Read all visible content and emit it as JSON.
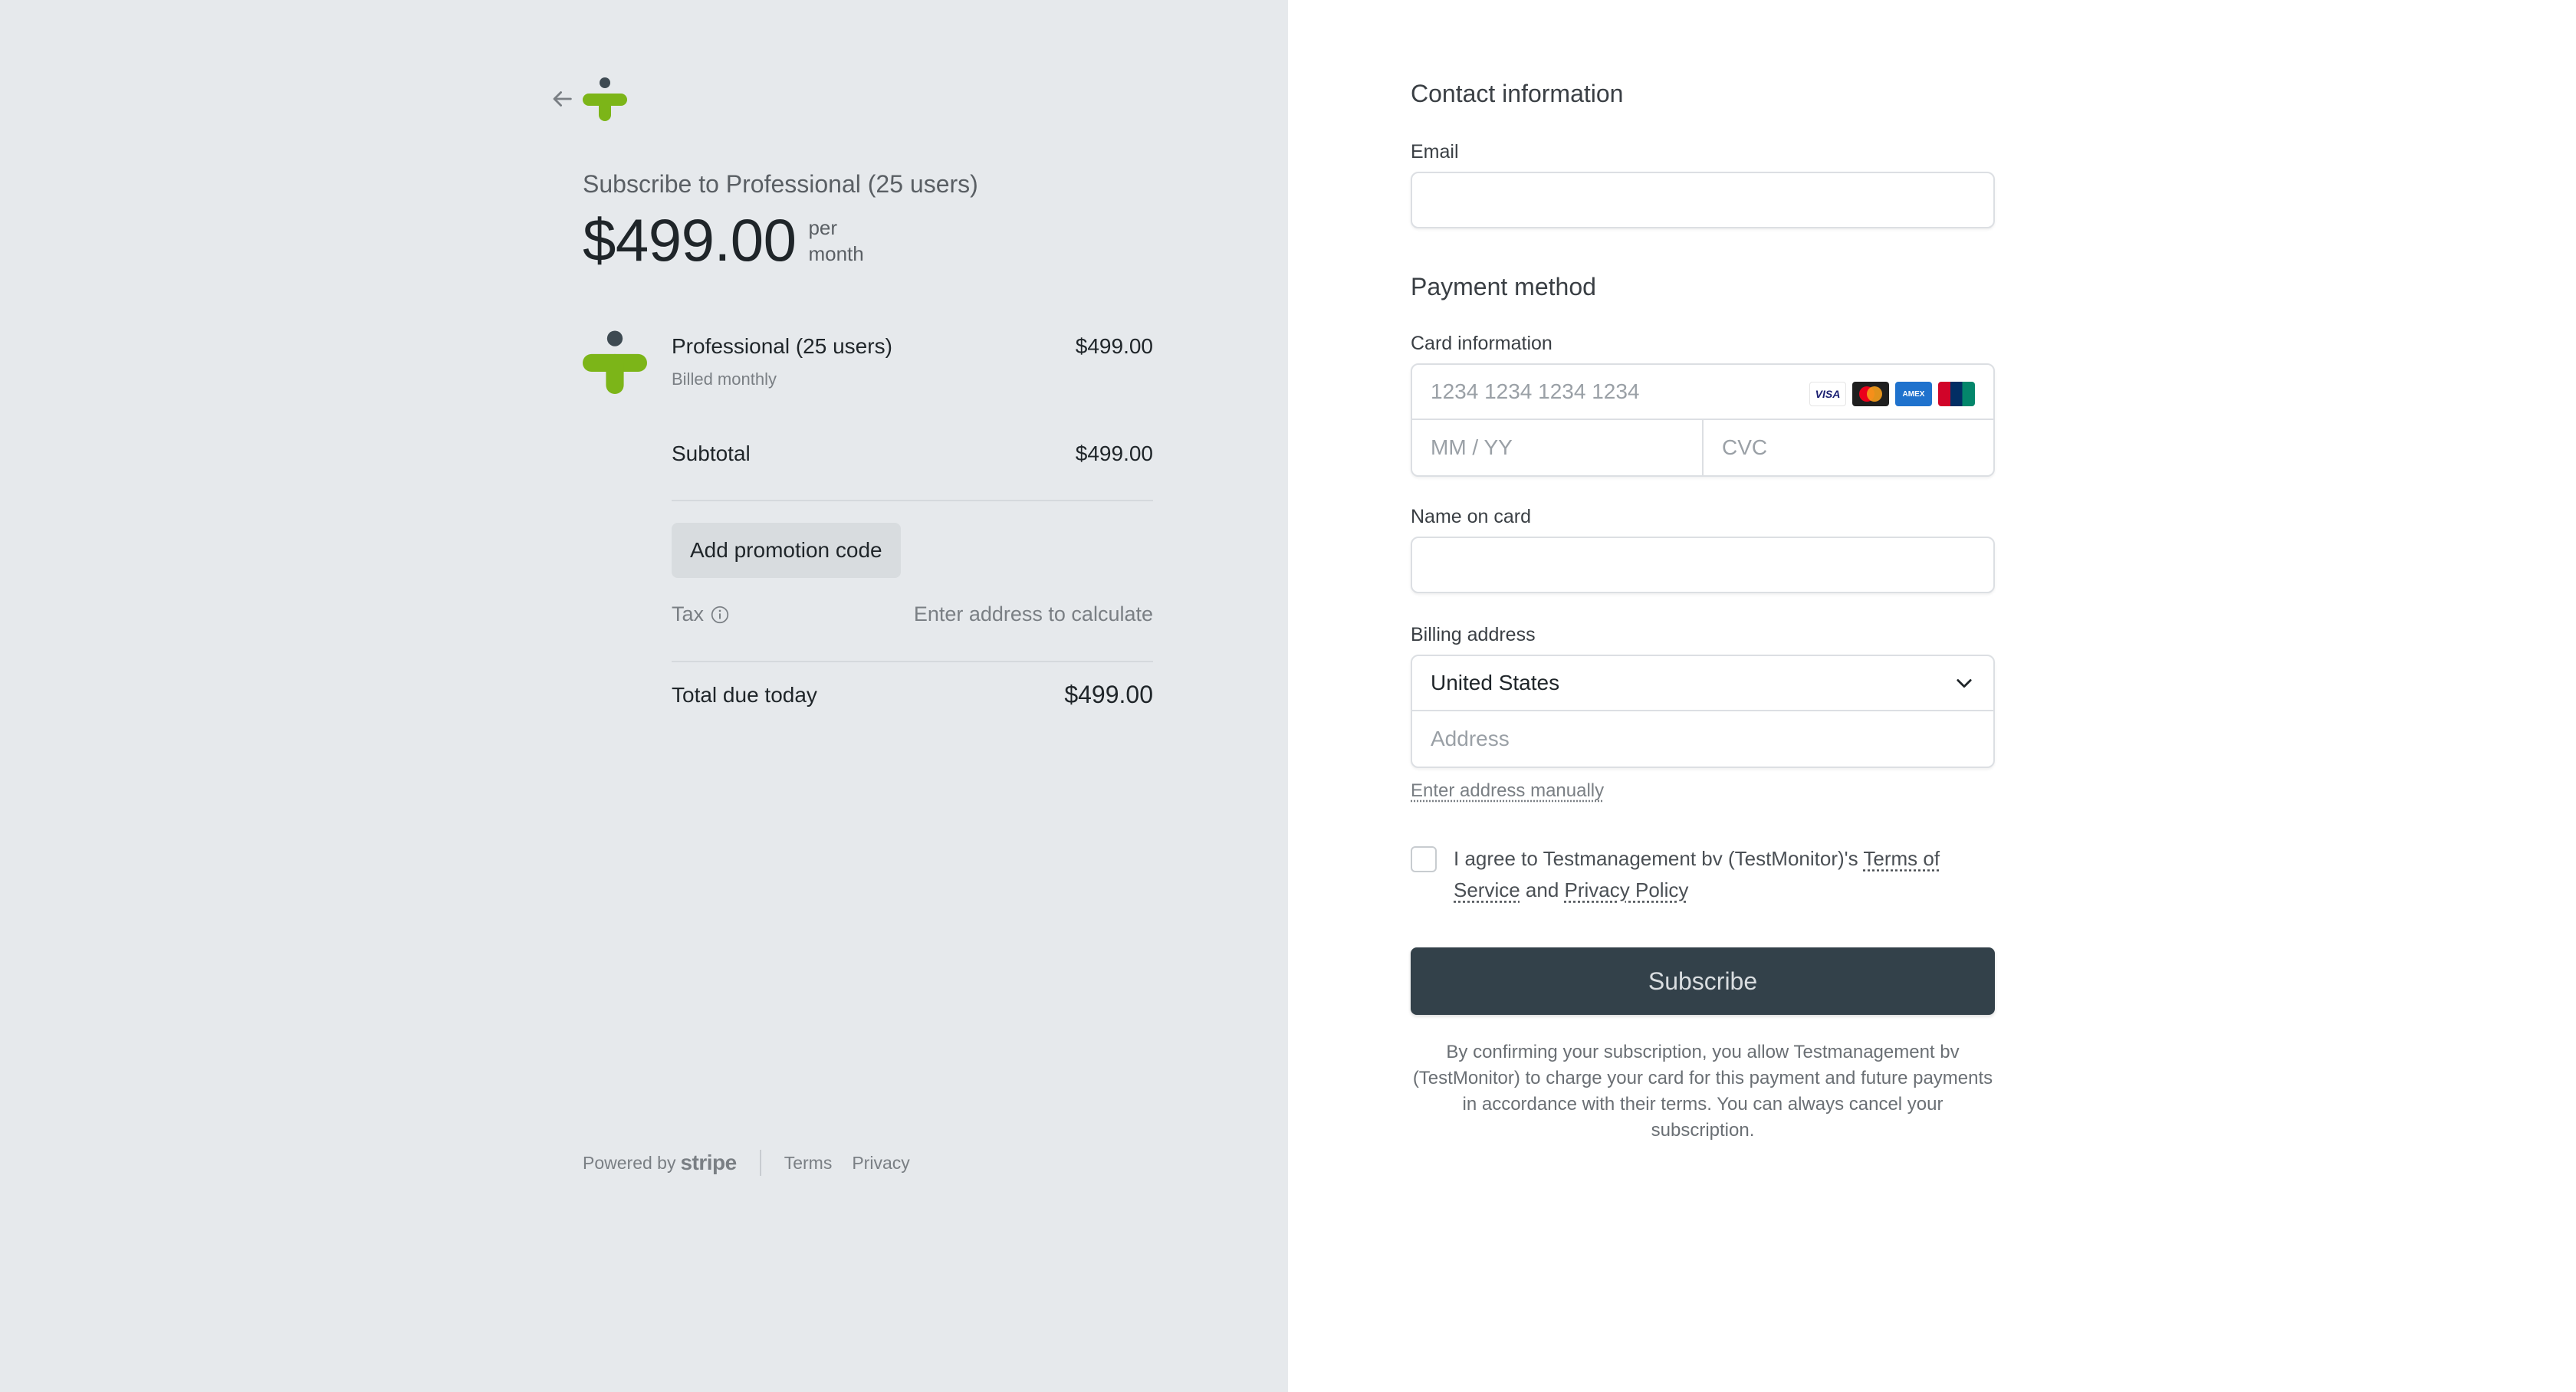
{
  "order": {
    "subscribe_title": "Subscribe to Professional (25 users)",
    "price": "$499.00",
    "per": "per",
    "period": "month",
    "item_name": "Professional (25 users)",
    "item_billing": "Billed monthly",
    "item_price": "$499.00",
    "subtotal_label": "Subtotal",
    "subtotal_value": "$499.00",
    "promo_label": "Add promotion code",
    "tax_label": "Tax",
    "tax_value": "Enter address to calculate",
    "total_label": "Total due today",
    "total_value": "$499.00"
  },
  "footer": {
    "powered_by": "Powered by",
    "stripe": "stripe",
    "terms": "Terms",
    "privacy": "Privacy"
  },
  "form": {
    "contact_title": "Contact information",
    "email_label": "Email",
    "payment_title": "Payment method",
    "card_label": "Card information",
    "card_number_placeholder": "1234 1234 1234 1234",
    "expiry_placeholder": "MM / YY",
    "cvc_placeholder": "CVC",
    "card_brands": [
      "VISA",
      "mastercard",
      "AMEX",
      "UnionPay"
    ],
    "name_label": "Name on card",
    "billing_label": "Billing address",
    "country": "United States",
    "address_placeholder": "Address",
    "manual_link": "Enter address manually",
    "agree_prefix": "I agree to Testmanagement bv (TestMonitor)'s ",
    "terms_link": "Terms of Service",
    "agree_and": " and ",
    "privacy_link": "Privacy Policy",
    "subscribe_label": "Subscribe",
    "confirm_text": "By confirming your subscription, you allow Testmanagement bv (TestMonitor) to charge your card for this payment and future payments in accordance with their terms. You can always cancel your subscription."
  },
  "colors": {
    "left_bg": "#e6e9ec",
    "brand_green": "#7cb518",
    "brand_dark": "#3e4a52",
    "button_dark": "#33414a"
  }
}
